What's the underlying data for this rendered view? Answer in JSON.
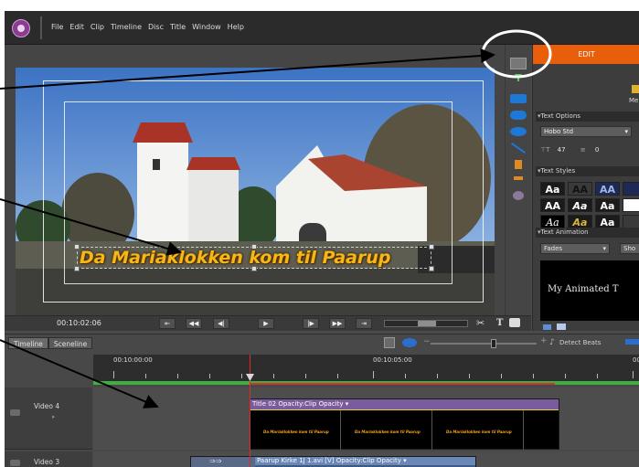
{
  "menu": [
    "File",
    "Edit",
    "Clip",
    "Timeline",
    "Disc",
    "Title",
    "Window",
    "Help"
  ],
  "monitor": {
    "title_text": "Da Mariaklokken kom til Paarup",
    "timecode": "00:10:02:06"
  },
  "transport_buttons": [
    "⇤",
    "◀◀",
    "◀|",
    "▶",
    "|▶",
    "▶▶",
    "⇥"
  ],
  "transport_icons": {
    "scissors": "✂",
    "title": "T",
    "camera": "📷"
  },
  "right_panel": {
    "edit_tab": "EDIT",
    "me_label": "Me",
    "text_options": "Text Options",
    "font": "Hobo Std",
    "size": "47",
    "leading": "0",
    "text_styles": "Text Styles",
    "style_swatches": [
      {
        "label": "Aa",
        "bg": "#1b1b1b",
        "fg": "#ffffff"
      },
      {
        "label": "AA",
        "bg": "#3a3a3a",
        "fg": "#111111"
      },
      {
        "label": "AA",
        "bg": "#1e2a55",
        "fg": "#9fb6e8"
      },
      {
        "label": "AA",
        "bg": "#1b1b1b",
        "fg": "#ffffff"
      },
      {
        "label": "Aa",
        "bg": "#1b1b1b",
        "fg": "#ffffff"
      },
      {
        "label": "Aa",
        "bg": "#1b1b1b",
        "fg": "#ffffff"
      },
      {
        "label": "Aa",
        "bg": "#000000",
        "fg": "#ffffff"
      },
      {
        "label": "Aa",
        "bg": "#1b1b1b",
        "fg": "#d8b640"
      },
      {
        "label": "Aa",
        "bg": "#1b1b1b",
        "fg": "#ffffff"
      }
    ],
    "text_animation": "Text Animation",
    "animation": "Fades",
    "show_button": "Sho",
    "preview_text": "My Animated T"
  },
  "timeline": {
    "tabs": [
      "Timeline",
      "Sceneline"
    ],
    "ruler_start": "00:10:00:00",
    "ruler_mid": "00:10:05:00",
    "ruler_end": "00",
    "detect_beats": "Detect Beats",
    "tracks": [
      "Video 4",
      "Video 3"
    ],
    "title_clip": "Title 02 Opacity:Clip Opacity ▾",
    "title_thumb_text": "Da Mariaklokken kom til Paarup",
    "video_clip": "Paarup Kirke 1J 1.avi [V] Opacity:Clip Opacity ▾",
    "transition_glyph": "⇒⇒"
  },
  "colors": {
    "accent": "#e85e0b",
    "title_clip": "#7a5b9c",
    "title_text": "#f5b81a",
    "playhead": "#e02a2a",
    "render_bar": "#3fb03f"
  }
}
